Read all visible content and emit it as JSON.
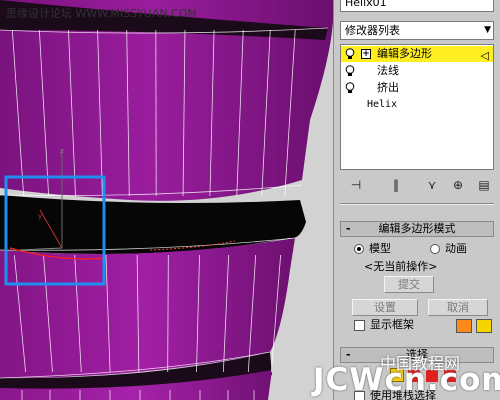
{
  "watermark_top_left": "思缘设计论坛 WWW.MISSYUAN.COM",
  "watermark_bottom": "JCWcn.com",
  "watermark_cn": "中国教程网",
  "viewport": {
    "axis_label_z": "z",
    "axis_label_y": "y",
    "axis_label_x": "x",
    "colors": {
      "surface": "#8b1a8f",
      "surface_dark": "#5c0e60",
      "wire": "#ffffff",
      "inner": "#0a0a0a",
      "gizmo_box": "#1e8ff0",
      "edge_sel": "#ff2020"
    }
  },
  "panel": {
    "object_name": "Helix01",
    "modifier_list": "修改器列表",
    "stack": [
      {
        "label": "编辑多边形",
        "selected": true,
        "has_plus": true
      },
      {
        "label": "法线",
        "selected": false,
        "has_plus": false
      },
      {
        "label": "挤出",
        "selected": false,
        "has_plus": false
      }
    ],
    "stack_base": "Helix",
    "stack_tools": [
      "pin-stack-icon",
      "show-end-result-icon",
      "make-unique-icon",
      "remove-modifier-icon",
      "configure-sets-icon"
    ],
    "rollout_edit_mode": {
      "title": "编辑多边形模式",
      "radio_model": "模型",
      "radio_anim": "动画",
      "no_op": "<无当前操作>",
      "commit": "提交",
      "setup": "设置",
      "cancel": "取消",
      "show_cage": "显示框架",
      "cage_color_1": "#ff8a1c",
      "cage_color_2": "#f5d400"
    },
    "rollout_select": {
      "title": "选择",
      "use_stack": "使用堆栈选择"
    }
  }
}
